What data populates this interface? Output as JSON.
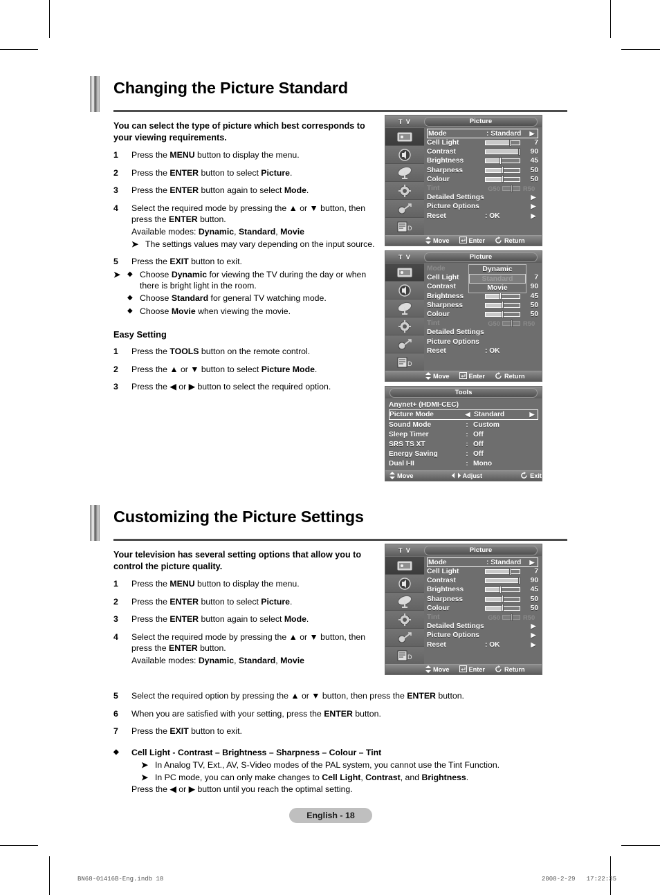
{
  "sections": [
    {
      "title": "Changing the Picture Standard",
      "lead": "You can select the type of picture which best corresponds to your viewing requirements.",
      "steps": [
        {
          "num": "1",
          "text": "Press the MENU button to display the menu."
        },
        {
          "num": "2",
          "text": "Press the ENTER button to select Picture."
        },
        {
          "num": "3",
          "text": "Press the ENTER button again to select Mode."
        },
        {
          "num": "4",
          "text": "Select the required mode by pressing the ▲ or ▼ button, then press the ENTER button."
        },
        {
          "num": "5",
          "text": "Press the EXIT button to exit."
        }
      ],
      "step4_modes": "Available modes: Dynamic, Standard, Movie",
      "step4_note": "The settings values may vary depending on the input source.",
      "bullets": [
        "Choose Dynamic for viewing the TV during the day or when there is bright light in the room.",
        "Choose Standard for general TV watching mode.",
        "Choose Movie when viewing the movie."
      ],
      "easy_setting": {
        "heading": "Easy Setting",
        "steps": [
          {
            "num": "1",
            "text": "Press the TOOLS button on the remote control."
          },
          {
            "num": "2",
            "text": "Press the ▲ or ▼ button to select Picture Mode."
          },
          {
            "num": "3",
            "text": "Press the ◀ or ▶ button to select the required option."
          }
        ]
      }
    },
    {
      "title": "Customizing the Picture Settings",
      "lead": "Your television has several setting options that allow you to control the picture quality.",
      "steps": [
        {
          "num": "1",
          "text": "Press the MENU button to display the menu."
        },
        {
          "num": "2",
          "text": "Press the ENTER button to select Picture."
        },
        {
          "num": "3",
          "text": "Press the ENTER button again to select Mode."
        },
        {
          "num": "4",
          "text": "Select the required mode by pressing the ▲ or ▼ button, then press the ENTER button."
        },
        {
          "num": "5",
          "text": "Select the required option by pressing the ▲ or ▼ button, then press the ENTER button."
        },
        {
          "num": "6",
          "text": "When you are satisfied with your setting, press the ENTER button."
        },
        {
          "num": "7",
          "text": "Press the EXIT button to exit."
        }
      ],
      "step4_modes": "Available modes: Dynamic, Standard, Movie",
      "final_bullet": "Cell Light - Contrast – Brightness – Sharpness – Colour – Tint",
      "final_notes": [
        "In Analog TV, Ext., AV, S-Video modes of the PAL system, you cannot use the Tint Function.",
        "In PC mode, you can only make changes to Cell Light, Contrast, and Brightness."
      ],
      "final_tail": "Press the ◀ or ▶ button until you reach the optimal setting."
    }
  ],
  "osd_picture": {
    "source_label": "T V",
    "title": "Picture",
    "rows": [
      {
        "label": "Mode",
        "value": ": Standard",
        "type": "value",
        "arrow": "▶",
        "highlight": true
      },
      {
        "label": "Cell Light",
        "type": "slider",
        "value": "7",
        "percent": 70
      },
      {
        "label": "Contrast",
        "type": "slider",
        "value": "90",
        "percent": 98
      },
      {
        "label": "Brightness",
        "type": "slider",
        "value": "45",
        "percent": 45
      },
      {
        "label": "Sharpness",
        "type": "slider",
        "value": "50",
        "percent": 50
      },
      {
        "label": "Colour",
        "type": "slider",
        "value": "50",
        "percent": 50
      },
      {
        "label": "Tint",
        "type": "tint",
        "left": "G50",
        "right": "R50",
        "percent": 50,
        "dim": true
      },
      {
        "label": "Detailed Settings",
        "type": "submenu",
        "arrow": "▶"
      },
      {
        "label": "Picture Options",
        "type": "submenu",
        "arrow": "▶"
      },
      {
        "label": "Reset",
        "value": ": OK",
        "type": "value",
        "arrow": "▶"
      }
    ],
    "footer": [
      {
        "icon": "updown-arrow-icon",
        "label": "Move"
      },
      {
        "icon": "enter-icon",
        "label": "Enter"
      },
      {
        "icon": "return-icon",
        "label": "Return"
      }
    ]
  },
  "osd_dropdown": {
    "source_label": "T V",
    "title": "Picture",
    "mode_label": "Mode",
    "mode_colon": ":",
    "options": [
      {
        "label": "Dynamic",
        "selected": false
      },
      {
        "label": "Standard",
        "selected": true
      },
      {
        "label": "Movie",
        "selected": false
      }
    ],
    "rows": [
      {
        "label": "Cell Light",
        "type": "slider",
        "value": "7",
        "percent": 70
      },
      {
        "label": "Contrast",
        "type": "slider",
        "value": "90",
        "percent": 98
      },
      {
        "label": "Brightness",
        "type": "slider",
        "value": "45",
        "percent": 45
      },
      {
        "label": "Sharpness",
        "type": "slider",
        "value": "50",
        "percent": 50
      },
      {
        "label": "Colour",
        "type": "slider",
        "value": "50",
        "percent": 50
      },
      {
        "label": "Tint",
        "type": "tint",
        "left": "G50",
        "right": "R50",
        "percent": 50,
        "dim": true
      },
      {
        "label": "Detailed Settings",
        "type": "plain"
      },
      {
        "label": "Picture Options",
        "type": "plain"
      },
      {
        "label": "Reset",
        "value": ": OK",
        "type": "value"
      }
    ],
    "footer": [
      {
        "icon": "updown-arrow-icon",
        "label": "Move"
      },
      {
        "icon": "enter-icon",
        "label": "Enter"
      },
      {
        "icon": "return-icon",
        "label": "Return"
      }
    ]
  },
  "osd_tools": {
    "title": "Tools",
    "header_item": "Anynet+ (HDMI-CEC)",
    "rows": [
      {
        "label": "Picture Mode",
        "left": "◀",
        "value": "Standard",
        "right": "▶",
        "highlight": true
      },
      {
        "label": "Sound Mode",
        "left": ":",
        "value": "Custom"
      },
      {
        "label": "Sleep Timer",
        "left": ":",
        "value": "Off"
      },
      {
        "label": "SRS TS XT",
        "left": ":",
        "value": "Off"
      },
      {
        "label": "Energy Saving",
        "left": ":",
        "value": "Off"
      },
      {
        "label": "Dual I-II",
        "left": ":",
        "value": "Mono"
      }
    ],
    "footer": [
      {
        "icon": "updown-arrow-icon",
        "label": "Move"
      },
      {
        "icon": "leftright-arrow-icon",
        "label": "Adjust"
      },
      {
        "icon": "exit-icon",
        "label": "Exit"
      }
    ]
  },
  "rail_icons": [
    "picture-icon",
    "sound-icon",
    "channel-icon",
    "setup-icon",
    "input-icon",
    "support-icon"
  ],
  "page_number": "English - 18",
  "print_footer": {
    "left": "BN68-01416B-Eng.indb   18",
    "right": "2008-2-29   17:22:35"
  }
}
